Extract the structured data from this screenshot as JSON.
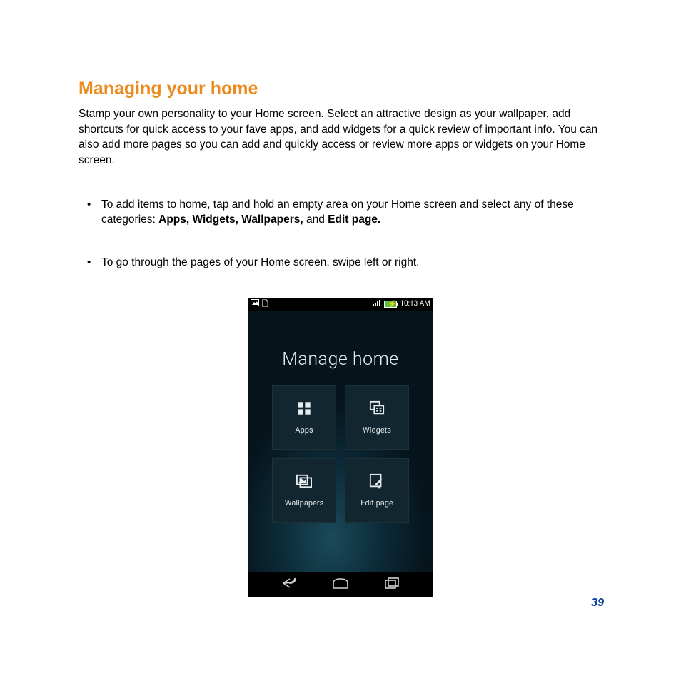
{
  "heading": "Managing your home",
  "intro": "Stamp your own personality to your Home screen. Select an attractive design as your wallpaper, add shortcuts for quick access to your fave apps, and add widgets for a quick review of important info.  You can also add more pages so you can add and quickly access or review more apps or widgets on  your Home screen.",
  "bullets": [
    {
      "pre": "To add items to home, tap and hold an empty area on your Home screen and select any of these categories: ",
      "bold": "Apps, Widgets, Wallpapers,",
      "mid": " and ",
      "bold2": "Edit page."
    },
    {
      "pre": "To go through the pages of your Home screen, swipe left or right.",
      "bold": "",
      "mid": "",
      "bold2": ""
    }
  ],
  "pageNumber": "39",
  "phone": {
    "statusbar": {
      "time": "10:13 AM"
    },
    "title": "Manage home",
    "tiles": {
      "apps": "Apps",
      "widgets": "Widgets",
      "wallpapers": "Wallpapers",
      "editpage": "Edit page"
    }
  }
}
